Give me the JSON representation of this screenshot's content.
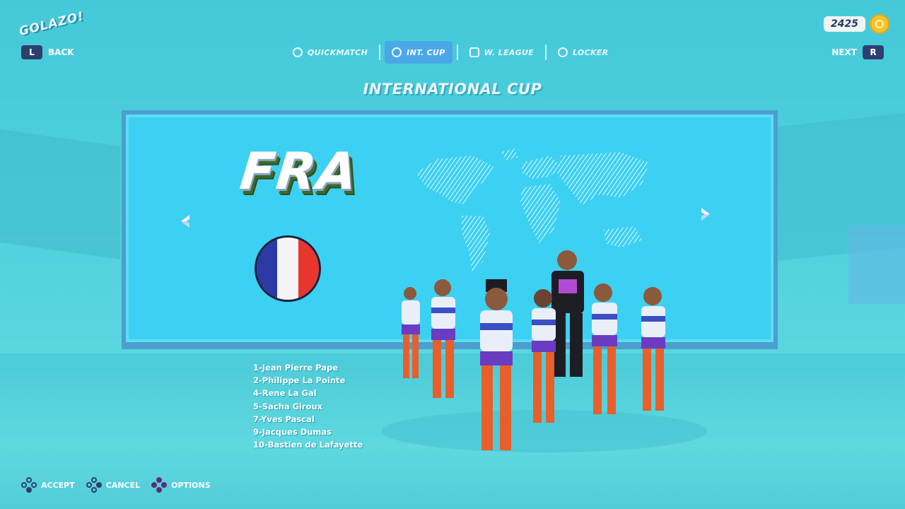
{
  "app": {
    "logo_text": "GOLAZO!"
  },
  "header": {
    "back": {
      "key": "L",
      "label": "BACK"
    },
    "next": {
      "label": "NEXT",
      "key": "R"
    },
    "coins": "2425"
  },
  "tabs": [
    {
      "label": "QUICKMATCH",
      "icon": "ball-icon",
      "active": false
    },
    {
      "label": "INT. CUP",
      "icon": "globe-icon",
      "active": true
    },
    {
      "label": "W. LEAGUE",
      "icon": "trophy-icon",
      "active": false
    },
    {
      "label": "LOCKER",
      "icon": "locker-icon",
      "active": false
    }
  ],
  "screen_title": "INTERNATIONAL CUP",
  "team": {
    "code": "FRA",
    "flag_colors": [
      "#2b3aa5",
      "#f4f4f6",
      "#e8362f"
    ],
    "roster": [
      "1-Jean Pierre Pape",
      "2-Philippe La Pointe",
      "4-Rene La Gal",
      "5-Sacha Giroux",
      "7-Yves Pascal",
      "9-Jacques Dumas",
      "10-Bastien de Lafayette"
    ]
  },
  "footer": [
    {
      "label": "ACCEPT",
      "icon": "accept-button-icon"
    },
    {
      "label": "CANCEL",
      "icon": "cancel-button-icon"
    },
    {
      "label": "OPTIONS",
      "icon": "options-dpad-icon"
    }
  ]
}
